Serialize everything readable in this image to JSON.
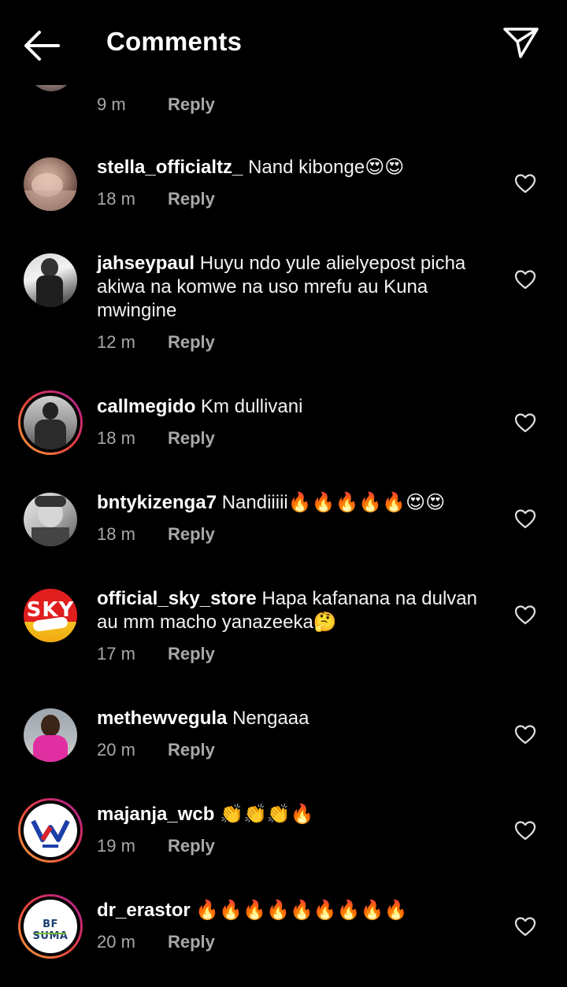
{
  "header": {
    "title": "Comments",
    "back_icon": "arrow-left-icon",
    "send_icon": "paper-plane-icon"
  },
  "top_partial": {
    "time": "9 m",
    "reply": "Reply"
  },
  "comments": [
    {
      "username": "stella_officialtz_",
      "text": "Nand kibonge😍😍",
      "time": "18 m",
      "reply": "Reply",
      "story_ring": false
    },
    {
      "username": "jahseypaul",
      "text": "Huyu ndo yule alielyepost picha akiwa na komwe na uso mrefu au Kuna mwingine",
      "time": "12 m",
      "reply": "Reply",
      "story_ring": false
    },
    {
      "username": "callmegido",
      "text": "Km dullivani",
      "time": "18 m",
      "reply": "Reply",
      "story_ring": true
    },
    {
      "username": "bntykizenga7",
      "text": "Nandiiiii🔥🔥🔥🔥🔥😍😍",
      "time": "18 m",
      "reply": "Reply",
      "story_ring": false
    },
    {
      "username": "official_sky_store",
      "text": "Hapa kafanana na dulvan au mm macho yanazeeka🤔",
      "time": "17 m",
      "reply": "Reply",
      "story_ring": false,
      "avatar_logo": "SKY Store"
    },
    {
      "username": "methewvegula",
      "text": "Nengaaa",
      "time": "20 m",
      "reply": "Reply",
      "story_ring": false
    },
    {
      "username": "majanja_wcb",
      "text": "👏👏👏🔥",
      "time": "19 m",
      "reply": "Reply",
      "story_ring": true,
      "avatar_logo": "WASAFI TV"
    },
    {
      "username": "dr_erastor",
      "text": "🔥🔥🔥🔥🔥🔥🔥🔥🔥",
      "time": "20 m",
      "reply": "Reply",
      "story_ring": true,
      "avatar_logo": "BF SUMA"
    }
  ],
  "colors": {
    "background": "#000000",
    "text": "#f2f2f2",
    "meta": "#a8a8a8",
    "ring_start": "#f7a33a",
    "ring_end": "#9d2aa8"
  }
}
